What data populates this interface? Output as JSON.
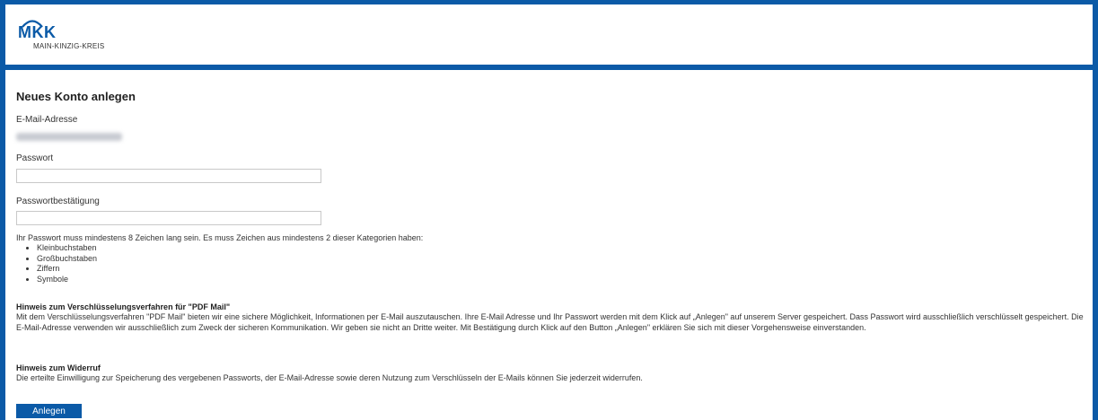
{
  "brand": {
    "mark": "MKK",
    "subtitle": "MAIN-KINZIG-KREIS"
  },
  "form": {
    "title": "Neues Konto anlegen",
    "email_label": "E-Mail-Adresse",
    "password_label": "Passwort",
    "password_value": "",
    "confirm_label": "Passwortbestätigung",
    "confirm_value": "",
    "requirements_intro": "Ihr Passwort muss mindestens 8 Zeichen lang sein. Es muss Zeichen aus mindestens 2 dieser Kategorien haben:",
    "requirements": [
      "Kleinbuchstaben",
      "Großbuchstaben",
      "Ziffern",
      "Symbole"
    ],
    "notice_encryption_title": "Hinweis zum Verschlüsselungsverfahren für \"PDF Mail\"",
    "notice_encryption_text": "Mit dem Verschlüsselungsverfahren \"PDF Mail\" bieten wir eine sichere Möglichkeit, Informationen per E-Mail auszutauschen. Ihre E-Mail Adresse und Ihr Passwort werden mit dem Klick auf „Anlegen\" auf unserem Server gespeichert. Dass Passwort wird ausschließlich verschlüsselt gespeichert. Die E-Mail-Adresse verwenden wir ausschließlich zum Zweck der sicheren Kommunikation. Wir geben sie nicht an Dritte weiter. Mit Bestätigung durch Klick auf den Button „Anlegen\" erklären Sie sich mit dieser Vorgehensweise einverstanden.",
    "notice_revocation_title": "Hinweis zum Widerruf",
    "notice_revocation_text": "Die erteilte Einwilligung zur Speicherung des vergebenen Passworts, der E-Mail-Adresse sowie deren Nutzung zum Verschlüsseln der E-Mails können Sie jederzeit widerrufen.",
    "submit_label": "Anlegen"
  },
  "colors": {
    "brand_blue": "#0b5aa7"
  }
}
